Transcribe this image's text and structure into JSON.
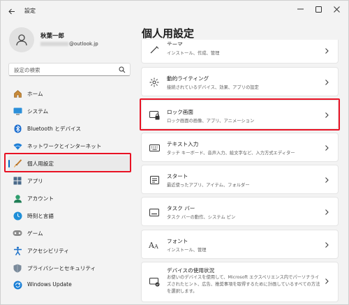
{
  "window": {
    "title": "設定"
  },
  "user": {
    "name": "秋葉一郎",
    "email_suffix": "@outlook.jp"
  },
  "search": {
    "placeholder": "設定の検索"
  },
  "sidebar": {
    "items": [
      {
        "label": "ホーム",
        "icon": "home-icon"
      },
      {
        "label": "システム",
        "icon": "system-icon"
      },
      {
        "label": "Bluetooth とデバイス",
        "icon": "bluetooth-icon"
      },
      {
        "label": "ネットワークとインターネット",
        "icon": "wifi-icon"
      },
      {
        "label": "個人用設定",
        "icon": "brush-icon",
        "selected": true
      },
      {
        "label": "アプリ",
        "icon": "apps-icon"
      },
      {
        "label": "アカウント",
        "icon": "account-icon"
      },
      {
        "label": "時刻と言語",
        "icon": "time-language-icon"
      },
      {
        "label": "ゲーム",
        "icon": "game-icon"
      },
      {
        "label": "アクセシビリティ",
        "icon": "accessibility-icon"
      },
      {
        "label": "プライバシーとセキュリティ",
        "icon": "shield-icon"
      },
      {
        "label": "Windows Update",
        "icon": "update-icon"
      }
    ]
  },
  "main": {
    "title": "個人用設定",
    "cards": [
      {
        "title": "テーマ",
        "subtitle": "インストール、作成、管理",
        "icon": "theme-icon"
      },
      {
        "title": "動的ライティング",
        "subtitle": "接続されているデバイス、効果、アプリの設定",
        "icon": "lighting-icon"
      },
      {
        "title": "ロック画面",
        "subtitle": "ロック画面の画像、アプリ、アニメーション",
        "icon": "lock-screen-icon",
        "highlighted": true
      },
      {
        "title": "テキスト入力",
        "subtitle": "タッチ キーボード、音声入力、絵文字など、入力方式エディター",
        "icon": "keyboard-icon"
      },
      {
        "title": "スタート",
        "subtitle": "最近使ったアプリ、アイテム、フォルダー",
        "icon": "start-icon"
      },
      {
        "title": "タスク バー",
        "subtitle": "タスク バーの動作、システム ピン",
        "icon": "taskbar-icon"
      },
      {
        "title": "フォント",
        "subtitle": "インストール、管理",
        "icon": "font-icon"
      },
      {
        "title": "デバイスの使用状況",
        "subtitle": "お使いのデバイスを使用して、Microsoft エクスペリエンス内でパーソナライズされたヒント、広告、推奨事項を取得するために計画しているすべての方法を選択します。",
        "icon": "device-usage-icon"
      }
    ]
  },
  "colors": {
    "accent": "#0067c0",
    "highlight": "#e81224"
  }
}
